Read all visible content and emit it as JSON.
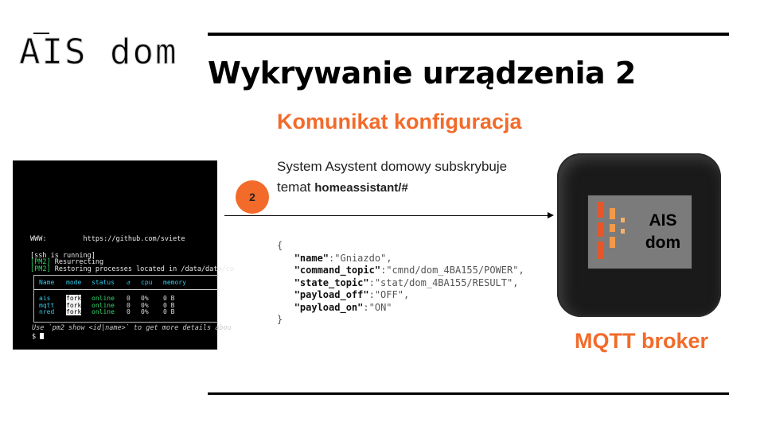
{
  "slide": {
    "title": "Wykrywanie urządzenia 2",
    "subtitle": "Komunikat konfiguracja",
    "description_text": "System Asystent domowy subskrybuje temat ",
    "topic": "homeassistant/#",
    "step_number": "2",
    "broker_label": "MQTT broker",
    "device_label_line1": "AIS",
    "device_label_line2": "dom",
    "accent_color": "#f26b2a"
  },
  "json_message": {
    "open": "{",
    "close": "}",
    "lines": [
      {
        "key": "\"name\"",
        "value": ":\"Gniazdo\","
      },
      {
        "key": "\"command_topic\"",
        "value": ":\"cmnd/dom_4BA155/POWER\","
      },
      {
        "key": "\"state_topic\"",
        "value": ":\"stat/dom_4BA155/RESULT\","
      },
      {
        "key": "\"payload_off\"",
        "value": ":\"OFF\","
      },
      {
        "key": "\"payload_on\"",
        "value": ":\"ON\""
      }
    ]
  },
  "terminal": {
    "logo": "AIS dom",
    "www_label": "WWW:",
    "www_url": "https://github.com/sviete",
    "line_ssh": "[ssh is running]",
    "pm2_tag": "[PM2]",
    "line_resurrect": " Resurrecting",
    "line_restore": " Restoring processes located in /data/data/co",
    "table": {
      "headers": [
        "Name",
        "mode",
        "status",
        "↺",
        "cpu",
        "memory"
      ],
      "names": [
        "ais",
        "mqtt",
        "nred"
      ],
      "modes": [
        "fork",
        "fork",
        "fork"
      ],
      "statuses": [
        "online",
        "online",
        "online"
      ],
      "restarts": [
        "0",
        "0",
        "0"
      ],
      "cpus": [
        "0%",
        "0%",
        "0%"
      ],
      "memories": [
        "0 B",
        "0 B",
        "0 B"
      ]
    },
    "hint": "Use `pm2 show <id|name>` to get more details abou",
    "prompt": "$"
  }
}
